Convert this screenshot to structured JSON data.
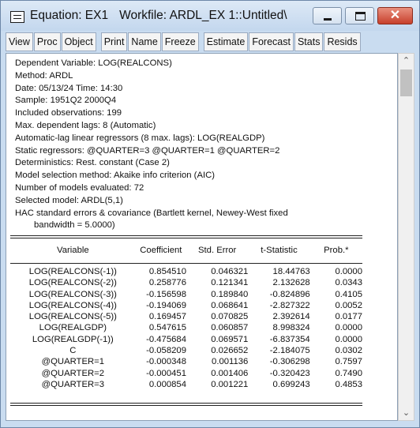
{
  "window": {
    "title": "Equation: EX1",
    "workfile": "Workfile: ARDL_EX 1::Untitled\\",
    "close_glyph": "✕"
  },
  "toolbar": {
    "buttons": [
      "View",
      "Proc",
      "Object",
      "Print",
      "Name",
      "Freeze",
      "Estimate",
      "Forecast",
      "Stats",
      "Resids"
    ]
  },
  "output": {
    "header_lines": [
      "Dependent Variable: LOG(REALCONS)",
      "Method: ARDL",
      "Date: 05/13/24   Time: 14:30",
      "Sample: 1951Q2 2000Q4",
      "Included observations: 199",
      "Max. dependent lags: 8 (Automatic)",
      "Automatic-lag linear regressors (8 max. lags): LOG(REALGDP)",
      "Static regressors: @QUARTER=3 @QUARTER=1 @QUARTER=2",
      "Deterministics: Rest. constant (Case 2)",
      "Model selection method: Akaike info criterion (AIC)",
      "Number of models evaluated: 72",
      "Selected model: ARDL(5,1)",
      "HAC standard errors & covariance (Bartlett kernel, Newey-West fixed"
    ],
    "header_continuation": "bandwidth = 5.0000)",
    "columns": [
      "Variable",
      "Coefficient",
      "Std. Error",
      "t-Statistic",
      "Prob.*"
    ],
    "rows": [
      [
        "LOG(REALCONS(-1))",
        "0.854510",
        "0.046321",
        "18.44763",
        "0.0000"
      ],
      [
        "LOG(REALCONS(-2))",
        "0.258776",
        "0.121341",
        "2.132628",
        "0.0343"
      ],
      [
        "LOG(REALCONS(-3))",
        "-0.156598",
        "0.189840",
        "-0.824896",
        "0.4105"
      ],
      [
        "LOG(REALCONS(-4))",
        "-0.194069",
        "0.068641",
        "-2.827322",
        "0.0052"
      ],
      [
        "LOG(REALCONS(-5))",
        "0.169457",
        "0.070825",
        "2.392614",
        "0.0177"
      ],
      [
        "LOG(REALGDP)",
        "0.547615",
        "0.060857",
        "8.998324",
        "0.0000"
      ],
      [
        "LOG(REALGDP(-1))",
        "-0.475684",
        "0.069571",
        "-6.837354",
        "0.0000"
      ],
      [
        "C",
        "-0.058209",
        "0.026652",
        "-2.184075",
        "0.0302"
      ],
      [
        "@QUARTER=1",
        "-0.000348",
        "0.001136",
        "-0.306298",
        "0.7597"
      ],
      [
        "@QUARTER=2",
        "-0.000451",
        "0.001406",
        "-0.320423",
        "0.7490"
      ],
      [
        "@QUARTER=3",
        "0.000854",
        "0.001221",
        "0.699243",
        "0.4853"
      ]
    ]
  }
}
